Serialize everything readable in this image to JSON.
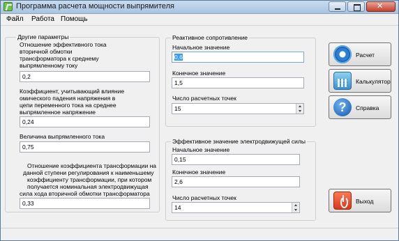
{
  "window": {
    "title": "Программа расчета мощности выпрямителя"
  },
  "menu": [
    "Файл",
    "Работа",
    "Помощь"
  ],
  "other": {
    "group_title": "Другие параметры",
    "p1_label": [
      "Отношение эффективного тока",
      "вторичной обмотки",
      "трансформатора к среднему",
      "выпрямленному току"
    ],
    "p1_value": "0,2",
    "p2_label": [
      "Коэффициент, учитывающий влияние",
      "омического падения напряжения в",
      "цепи переменного тока на среднее",
      "выпрямленное напряжение"
    ],
    "p2_value": "0,24",
    "p3_label": "Величина выпрямленного тока",
    "p3_value": "0,75",
    "p4_label": [
      "Отношение коэффициента трансформации на",
      "данной ступени регулирования к наименьшему",
      "коэффициенту трансформации, при котором",
      "получается номинальная электродвижущая",
      "сила хода вторичной обмотки трансформатора"
    ],
    "p4_value": "0,33"
  },
  "reactive": {
    "group_title": "Реактивное сопротивление",
    "start_label": "Начальное значение",
    "start_value": "0,6",
    "end_label": "Конечное значение",
    "end_value": "1,5",
    "points_label": "Число расчетных точек",
    "points_value": "15"
  },
  "emf": {
    "group_title": "Эффективное значение электродвижущей силы",
    "start_label": "Начальное значение",
    "start_value": "0,15",
    "end_label": "Конечное значение",
    "end_value": "2,6",
    "points_label": "Число расчетных точек",
    "points_value": "14"
  },
  "buttons": {
    "calc": {
      "label": "Расчет",
      "icon": "gear-icon"
    },
    "calculator": {
      "label": "Калькулятор",
      "icon": "calculator-icon"
    },
    "help": {
      "label": "Справка",
      "icon": "help-icon",
      "glyph": "?"
    },
    "exit": {
      "label": "Выход",
      "icon": "power-icon"
    }
  }
}
